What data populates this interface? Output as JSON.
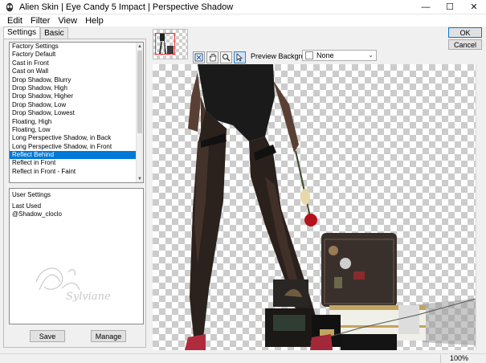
{
  "window": {
    "title": "Alien Skin | Eye Candy 5 Impact | Perspective Shadow",
    "minimize": "—",
    "maximize": "☐",
    "close": "✕"
  },
  "menu": [
    "Edit",
    "Filter",
    "View",
    "Help"
  ],
  "tabs": {
    "settings": "Settings",
    "basic": "Basic"
  },
  "presets": {
    "items": [
      "Factory Settings",
      "Factory Default",
      "Cast in Front",
      "Cast on Wall",
      "Drop Shadow, Blurry",
      "Drop Shadow, High",
      "Drop Shadow, Higher",
      "Drop Shadow, Low",
      "Drop Shadow, Lowest",
      "Floating, High",
      "Floating, Low",
      "Long Perspective Shadow, in Back",
      "Long Perspective Shadow, in Front",
      "Reflect Behind",
      "Reflect in Front",
      "Reflect in Front - Faint"
    ],
    "selected_index": 13
  },
  "user_settings": {
    "items": [
      "User Settings",
      "Last Used",
      "@Shadow_cloclo"
    ]
  },
  "buttons": {
    "save": "Save",
    "manage": "Manage",
    "ok": "OK",
    "cancel": "Cancel"
  },
  "preview": {
    "background_label": "Preview Background:",
    "background_value": "None"
  },
  "status": {
    "zoom": "100%"
  },
  "colors": {
    "selection": "#0078d7",
    "thumb_highlight": "#e33333"
  },
  "icons": {
    "tools": [
      "zoom-to-fit-icon",
      "hand-pan-icon",
      "magnifier-icon",
      "arrow-select-icon"
    ]
  }
}
